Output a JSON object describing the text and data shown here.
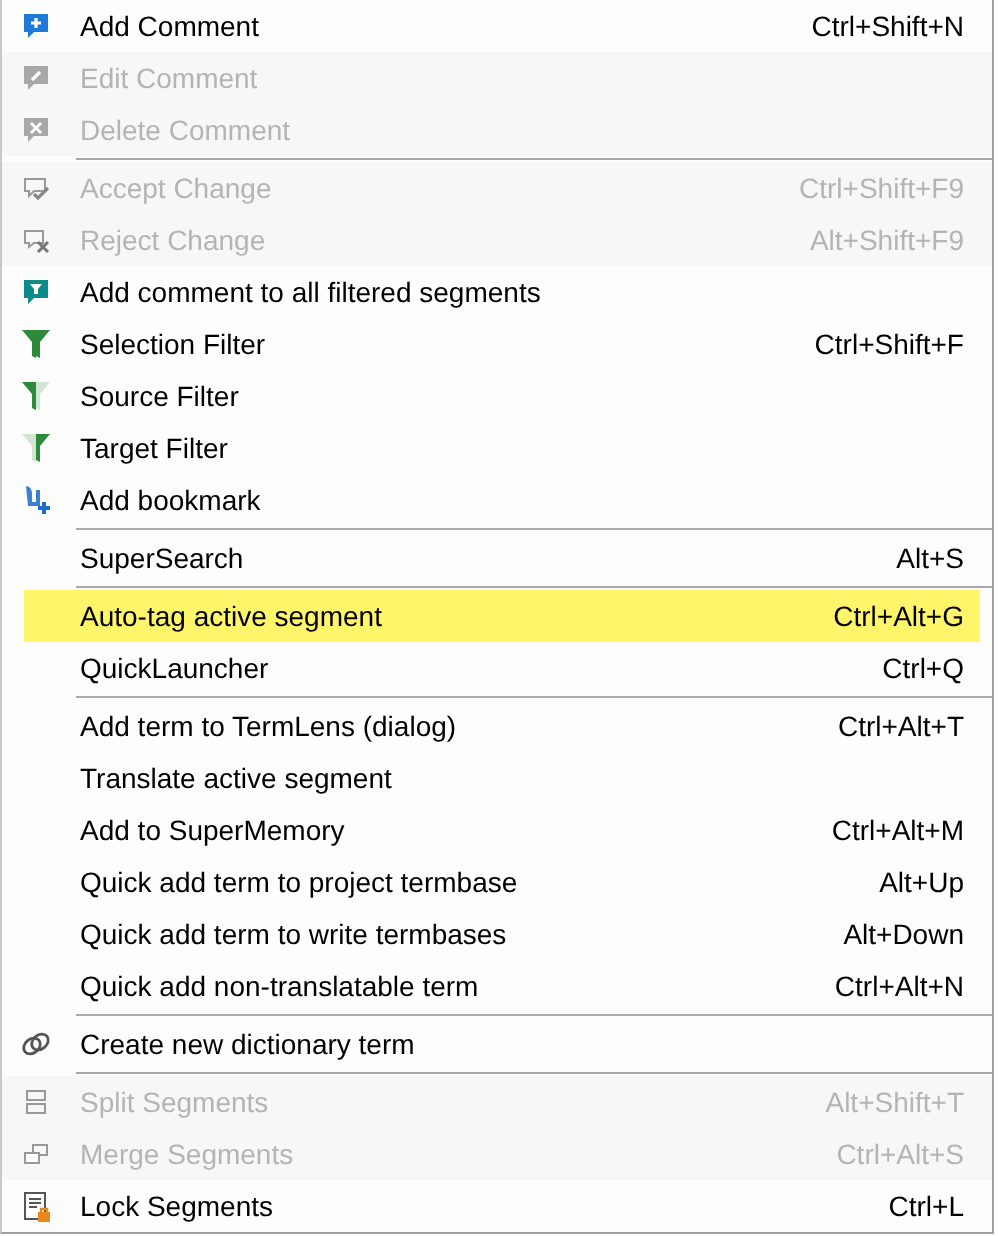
{
  "menu": [
    {
      "kind": "item",
      "label": "Add Comment",
      "shortcut": "Ctrl+Shift+N",
      "disabled": false,
      "selected": false
    },
    {
      "kind": "item",
      "label": "Edit Comment",
      "disabled": true,
      "selected": false
    },
    {
      "kind": "item",
      "label": "Delete Comment",
      "disabled": true,
      "selected": false
    },
    {
      "kind": "separator"
    },
    {
      "kind": "item",
      "label": "Accept Change",
      "shortcut": "Ctrl+Shift+F9",
      "disabled": true,
      "selected": false
    },
    {
      "kind": "item",
      "label": "Reject Change",
      "shortcut": "Alt+Shift+F9",
      "disabled": true,
      "selected": false
    },
    {
      "kind": "item",
      "label": "Add comment to all filtered segments",
      "disabled": false,
      "selected": false
    },
    {
      "kind": "item",
      "label": "Selection Filter",
      "shortcut": "Ctrl+Shift+F",
      "disabled": false,
      "selected": false
    },
    {
      "kind": "item",
      "label": "Source Filter",
      "disabled": false,
      "selected": false
    },
    {
      "kind": "item",
      "label": "Target Filter",
      "disabled": false,
      "selected": false
    },
    {
      "kind": "item",
      "label": "Add bookmark",
      "disabled": false,
      "selected": false
    },
    {
      "kind": "separator"
    },
    {
      "kind": "item",
      "label": "SuperSearch",
      "shortcut": "Alt+S",
      "disabled": false,
      "selected": false
    },
    {
      "kind": "separator"
    },
    {
      "kind": "item",
      "label": "Auto-tag active segment",
      "shortcut": "Ctrl+Alt+G",
      "disabled": false,
      "selected": true
    },
    {
      "kind": "item",
      "label": "QuickLauncher",
      "shortcut": "Ctrl+Q",
      "disabled": false,
      "selected": false
    },
    {
      "kind": "separator"
    },
    {
      "kind": "item",
      "label": "Add term to TermLens (dialog)",
      "shortcut": "Ctrl+Alt+T",
      "disabled": false,
      "selected": false
    },
    {
      "kind": "item",
      "label": "Translate active segment",
      "disabled": false,
      "selected": false
    },
    {
      "kind": "item",
      "label": "Add to SuperMemory",
      "shortcut": "Ctrl+Alt+M",
      "disabled": false,
      "selected": false
    },
    {
      "kind": "item",
      "label": "Quick add term to project termbase",
      "shortcut": "Alt+Up",
      "disabled": false,
      "selected": false
    },
    {
      "kind": "item",
      "label": "Quick add term to write termbases",
      "shortcut": "Alt+Down",
      "disabled": false,
      "selected": false
    },
    {
      "kind": "item",
      "label": "Quick add non-translatable term",
      "shortcut": "Ctrl+Alt+N",
      "disabled": false,
      "selected": false
    },
    {
      "kind": "separator"
    },
    {
      "kind": "item",
      "label": "Create new dictionary term",
      "disabled": false,
      "selected": false
    },
    {
      "kind": "separator"
    },
    {
      "kind": "item",
      "label": "Split Segments",
      "shortcut": "Alt+Shift+T",
      "disabled": true,
      "selected": false
    },
    {
      "kind": "item",
      "label": "Merge Segments",
      "shortcut": "Ctrl+Alt+S",
      "disabled": true,
      "selected": false
    },
    {
      "kind": "item",
      "label": "Lock Segments",
      "shortcut": "Ctrl+L",
      "disabled": false,
      "selected": false
    }
  ]
}
